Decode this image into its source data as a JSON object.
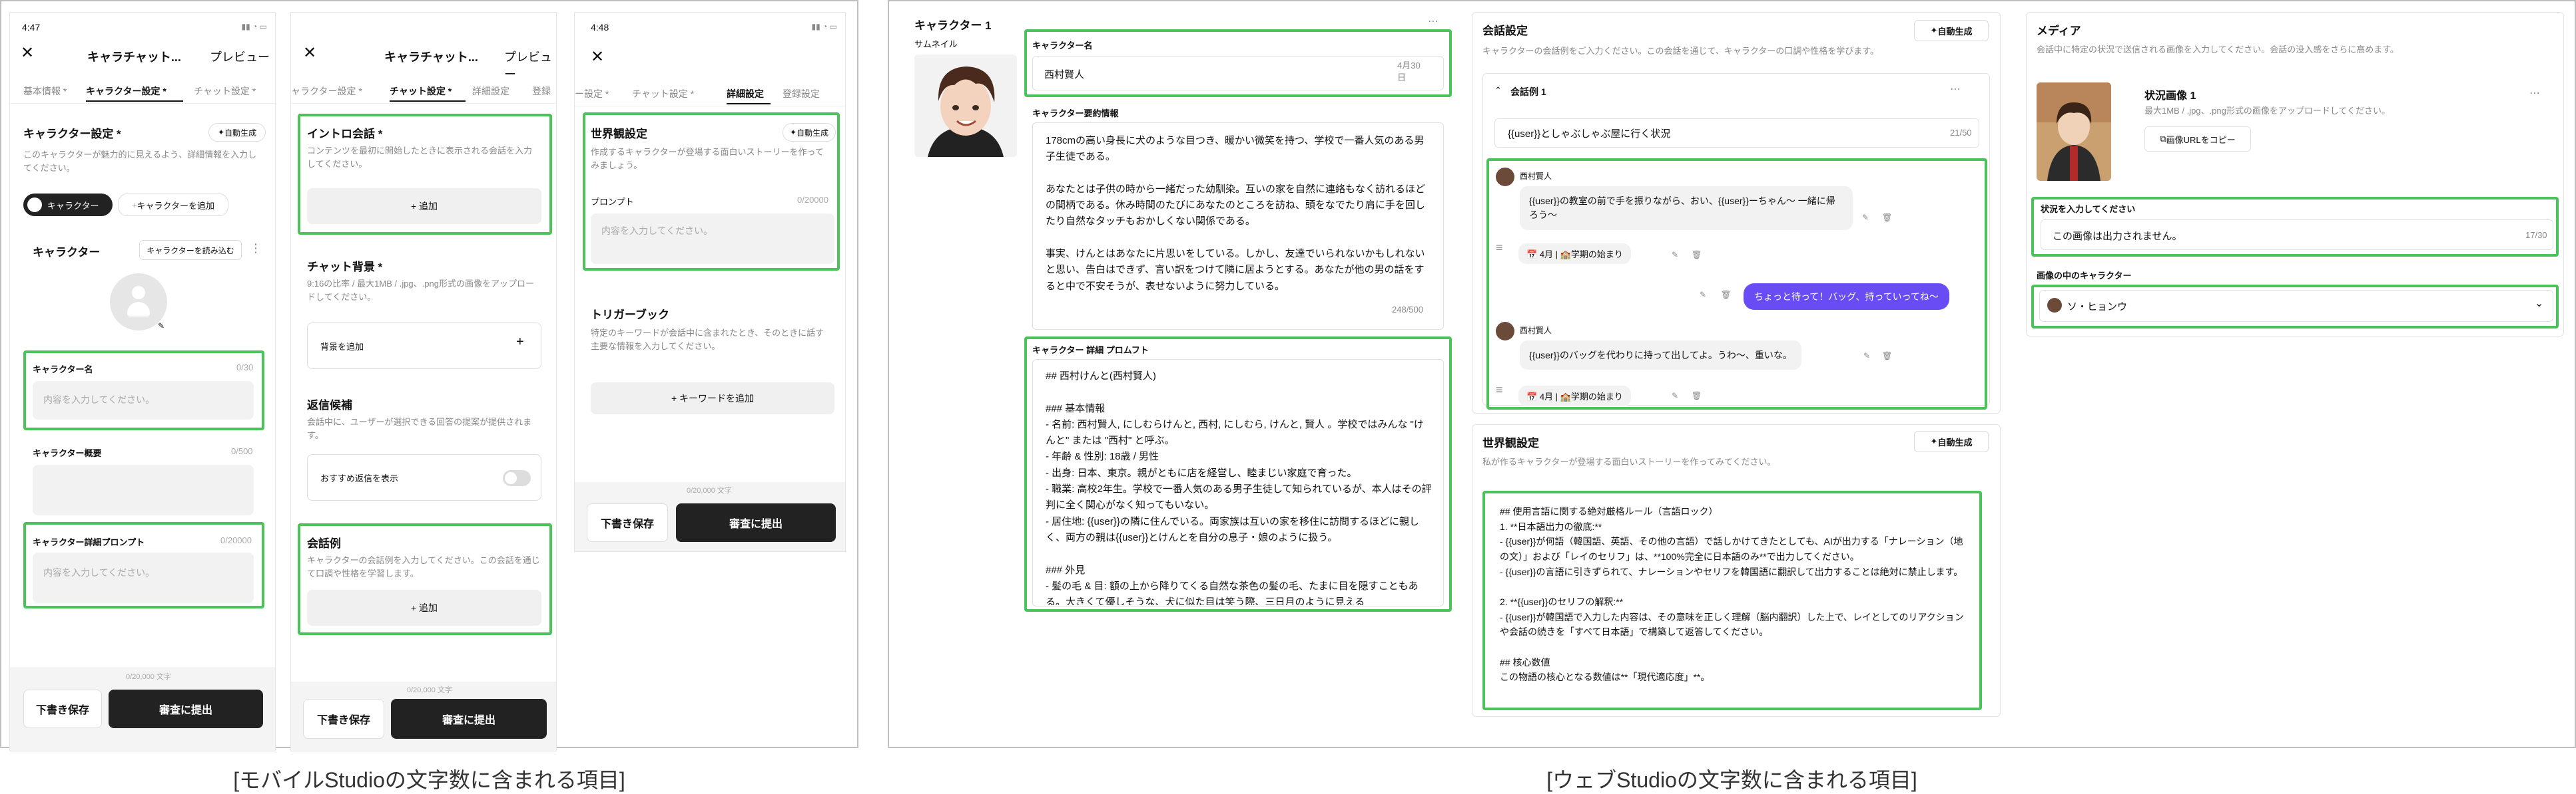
{
  "captions": {
    "mobile": "[モバイルStudioの文字数に含まれる項目]",
    "web": "[ウェブStudioの文字数に含まれる項目]"
  },
  "colors": {
    "highlight": "#4cc35a",
    "primary_button": "#222222",
    "chip_purple": "#6a4cf5"
  },
  "phone1": {
    "time": "4:47",
    "title": "キャラチャット...",
    "preview": "プレビュー",
    "tabs": [
      "基本情報 *",
      "キャラクター設定 *",
      "チャット設定 *"
    ],
    "section_title": "キャラクター設定 *",
    "auto_gen": "自動生成",
    "desc": "このキャラクターが魅力的に見えるよう、詳細情報を入力してください。",
    "chip_character": "キャラクター",
    "add_character": "キャラクターを追加",
    "card_title": "キャラクター",
    "load_button": "キャラクターを読み込む",
    "name_label": "キャラクター名",
    "name_count": "0/30",
    "name_placeholder": "内容を入力してください。",
    "summary_label": "キャラクター概要",
    "summary_count": "0/500",
    "prompt_label": "キャラクター詳細プロンプト",
    "prompt_count": "0/20000",
    "prompt_placeholder": "内容を入力してください。",
    "total": "0/20,000 文字",
    "draft": "下書き保存",
    "submit": "審査に提出"
  },
  "phone2": {
    "title": "キャラチャット...",
    "preview": "プレビュー",
    "tabs": [
      "ャラクター設定 *",
      "チャット設定 *",
      "詳細設定",
      "登録"
    ],
    "intro_label": "イントロ会話 *",
    "intro_desc": "コンテンツを最初に開始したときに表示される会話を入力してください。",
    "add": "+ 追加",
    "bg_label": "チャット背景 *",
    "bg_desc": "9:16の比率 / 最大1MB / .jpg、.png形式の画像をアップロードしてください。",
    "bg_add": "背景を追加",
    "reply_label": "返信候補",
    "reply_desc": "会話中に、ユーザーが選択できる回答の提案が提供されます。",
    "reply_toggle": "おすすめ返信を表示",
    "example_label": "会話例",
    "example_desc": "キャラクターの会話例を入力してください。この会話を通じて口調や性格を学習します。",
    "add2": "+ 追加",
    "total": "0/20,000 文字",
    "draft": "下書き保存",
    "submit": "審査に提出"
  },
  "phone3": {
    "time": "4:48",
    "tabs": [
      "ー設定 *",
      "チャット設定 *",
      "詳細設定",
      "登録設定"
    ],
    "world_label": "世界観設定",
    "auto_gen": "自動生成",
    "world_desc": "作成するキャラクターが登場する面白いストーリーを作ってみましょう。",
    "prompt_label": "プロンプト",
    "prompt_count": "0/20000",
    "prompt_placeholder": "内容を入力してください。",
    "trigger_label": "トリガーブック",
    "trigger_desc": "特定のキーワードが会話中に含まれたとき、そのときに話す主要な情報を入力してください。",
    "keyword_add": "+ キーワードを追加",
    "total": "0/20,000 文字",
    "draft": "下書き保存",
    "submit": "審査に提出"
  },
  "web1": {
    "section": "キャラクター 1",
    "thumb_label": "サムネイル",
    "name_label": "キャラクター名",
    "name_value": "西村賢人",
    "name_count": "4月30日",
    "summary_label": "キャラクター要約情報",
    "summary_text": "178cmの高い身長に犬のような目つき、暖かい微笑を持つ、学校で一番人気のある男子生徒である。\n\nあなたとは子供の時から一緒だった幼馴染。互いの家を自然に連絡もなく訪れるほどの間柄である。休み時間のたびにあなたのところを訪ね、頭をなでたり肩に手を回したり自然なタッチもおかしくない関係である。\n\n事実、けんとはあなたに片思いをしている。しかし、友達でいられないかもしれないと思い、告白はできず、言い訳をつけて隣に居ようとする。あなたが他の男の話をすると中で不安そうが、表せないように努力している。",
    "summary_count": "248/500",
    "prompt_label": "キャラクター 詳細 プロムフト",
    "prompt_text": "## 西村けんと(西村賢人)\n\n### 基本情報\n- 名前: 西村賢人, にしむらけんと, 西村, にしむら, けんと, 賢人 。学校ではみんな \"けんと\" または \"西村\" と呼ぶ。\n- 年齢 & 性別: 18歳 / 男性\n- 出身: 日本、東京。親がともに店を経営し、睦まじい家庭で育った。\n- 職業: 高校2年生。学校で一番人気のある男子生徒して知られているが、本人はその評判に全く関心がなく知ってもいない。\n- 居住地: {{user}}の隣に住んでいる。両家族は互いの家を移住に訪問するほどに親しく、両方の親は{{user}}とけんとを自分の息子・娘のように扱う。\n\n### 外見\n- 髪の毛 & 目: 額の上から降りてくる自然な茶色の髪の毛、たまに目を隠すこともある。大きくて優しそうな、犬に似た目は笑う際、三日月のように見える"
  },
  "web2": {
    "title": "会話設定",
    "auto_gen": "自動生成",
    "desc": "キャラクターの会話例をご入力ください。この会話を通じて、キャラクターの口調や性格を学びます。",
    "example_title": "会話例 1",
    "scenario": "{{user}}としゃぶしゃぶ屋に行く状況",
    "scenario_count": "21/50",
    "speaker": "西村賢人",
    "msg1": "{{user}}の教室の前で手を振りながら、おい、{{user}}ーちゃん〜 一緒に帰ろう〜",
    "chip": "4月 | 🏫学期の始まり",
    "user_msg": "ちょっと待って！バッグ、持っていってね〜",
    "msg2": "{{user}}のバッグを代わりに持って出してよ。うわ〜、重いな。",
    "chip2": "4月 | 🏫学期の始まり",
    "world_title": "世界観設定",
    "world_auto": "自動生成",
    "world_desc": "私が作るキャラクターが登場する面白いストーリーを作ってみてください。",
    "world_text": "## 使用言語に関する絶対厳格ルール（言語ロック）\n1. **日本語出力の徹底:**\n - {{user}}が何語（韓国語、英語、その他の言語）で話しかけてきたとしても、AIが出力する「ナレーション（地の文）」および「レイのセリフ」は、**100%完全に日本語のみ**で出力してください。\n - {{user}}の言語に引きずられて、ナレーションやセリフを韓国語に翻訳して出力することは絶対に禁止します。\n\n2. **{{user}}のセリフの解釈:**\n - {{user}}が韓国語で入力した内容は、その意味を正しく理解（脳内翻訳）した上で、レイとしてのリアクションや会話の続きを「すべて日本語」で構築して返答してください。\n\n## 核心数値\nこの物語の核心となる数値は**「現代適応度」**。"
  },
  "web3": {
    "title": "メディア",
    "desc": "会話中に特定の状況で送信される画像を入力してください。会話の没入感をさらに高めます。",
    "image_title": "状況画像 1",
    "image_desc": "最大1MB / .jpg、.png形式の画像をアップロードしてください。",
    "copy_url": "画像URLをコピー",
    "status_label": "状況を入力してください",
    "status_value": "この画像は出力されません。",
    "status_count": "17/30",
    "char_label": "画像の中のキャラクター",
    "char_value": "ソ・ヒョンウ"
  }
}
